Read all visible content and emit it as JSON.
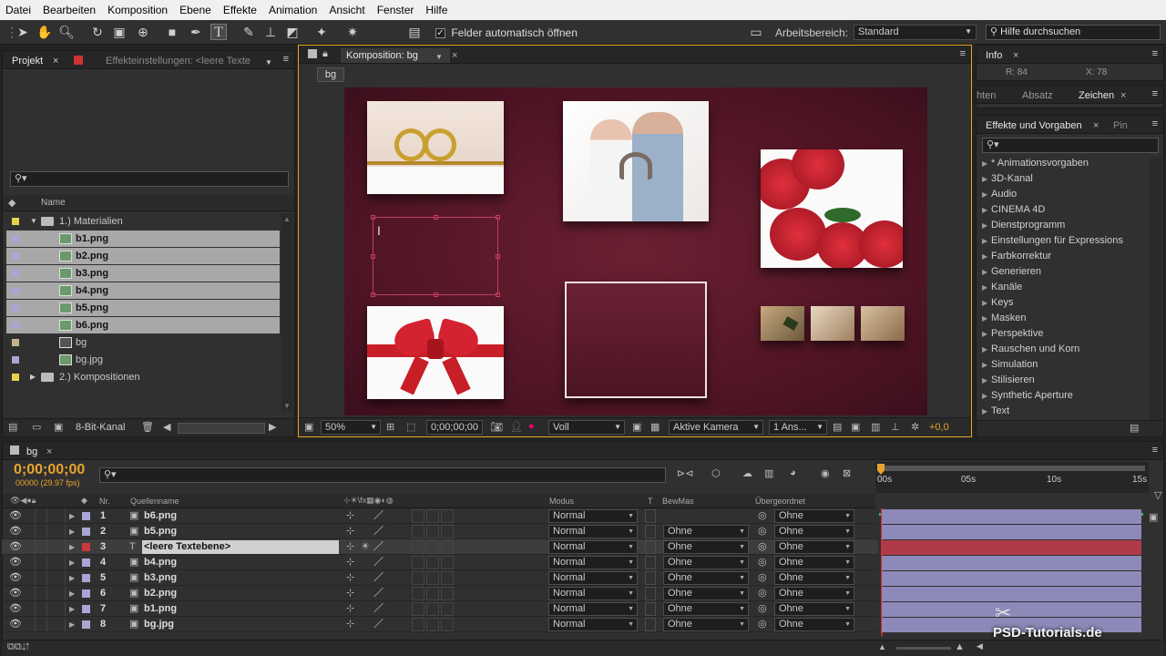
{
  "menu": [
    "Datei",
    "Bearbeiten",
    "Komposition",
    "Ebene",
    "Effekte",
    "Animation",
    "Ansicht",
    "Fenster",
    "Hilfe"
  ],
  "toolbar": {
    "auto_open_label": "Felder automatisch öffnen",
    "workspace_label": "Arbeitsbereich:",
    "workspace_value": "Standard",
    "help_placeholder": "Hilfe durchsuchen"
  },
  "project_panel": {
    "tab_project": "Projekt",
    "tab_effects": "Effekteinstellungen: <leere Texte",
    "column_name": "Name",
    "bit_depth": "8-Bit-Kanal",
    "items": [
      {
        "name": "1.) Materialien",
        "type": "folder",
        "color": "#e6d24a",
        "level": 0,
        "expanded": true,
        "selected": false
      },
      {
        "name": "b1.png",
        "type": "image",
        "color": "#a9a6d6",
        "level": 1,
        "selected": true
      },
      {
        "name": "b2.png",
        "type": "image",
        "color": "#a9a6d6",
        "level": 1,
        "selected": true
      },
      {
        "name": "b3.png",
        "type": "image",
        "color": "#a9a6d6",
        "level": 1,
        "selected": true
      },
      {
        "name": "b4.png",
        "type": "image",
        "color": "#a9a6d6",
        "level": 1,
        "selected": true
      },
      {
        "name": "b5.png",
        "type": "image",
        "color": "#a9a6d6",
        "level": 1,
        "selected": true
      },
      {
        "name": "b6.png",
        "type": "image",
        "color": "#a9a6d6",
        "level": 1,
        "selected": true
      },
      {
        "name": "bg",
        "type": "comp",
        "color": "#c4b28e",
        "level": 1,
        "selected": false
      },
      {
        "name": "bg.jpg",
        "type": "image",
        "color": "#a9a6d6",
        "level": 1,
        "selected": false
      },
      {
        "name": "2.) Kompositionen",
        "type": "folder",
        "color": "#e6d24a",
        "level": 0,
        "expanded": false,
        "selected": false
      }
    ]
  },
  "composition_panel": {
    "tab_label": "Komposition: bg",
    "breadcrumb": "bg",
    "zoom": "50%",
    "timecode": "0;00;00;00",
    "resolution": "Voll",
    "camera": "Aktive Kamera",
    "views": "1 Ans...",
    "exposure": "+0,0"
  },
  "info_panel": {
    "tab_label": "Info",
    "r_label": "R: 84",
    "x_label": "X: 78"
  },
  "char_panel": {
    "tabs": [
      "hten",
      "Absatz",
      "Zeichen"
    ]
  },
  "effects_panel": {
    "tab_label": "Effekte und Vorgaben",
    "tab_pinsel": "Pin",
    "items": [
      "* Animationsvorgaben",
      "3D-Kanal",
      "Audio",
      "CINEMA 4D",
      "Dienstprogramm",
      "Einstellungen für Expressions",
      "Farbkorrektur",
      "Generieren",
      "Kanäle",
      "Keys",
      "Masken",
      "Perspektive",
      "Rauschen und Korn",
      "Simulation",
      "Stilisieren",
      "Synthetic Aperture",
      "Text"
    ]
  },
  "timeline": {
    "tab_label": "bg",
    "timecode": "0;00;00;00",
    "frame_info": "00000 (29.97 fps)",
    "columns": {
      "nr": "Nr.",
      "source": "Quellenname",
      "mode": "Modus",
      "t": "T",
      "trkmat": "BewMas",
      "parent": "Übergeordnet"
    },
    "ruler": [
      "00s",
      "05s",
      "10s",
      "15s"
    ],
    "layers": [
      {
        "nr": "1",
        "name": "b6.png",
        "type": "image",
        "color": "#a9a6d6",
        "mode": "Normal",
        "trkmat": "",
        "parent": "Ohne",
        "selected": false
      },
      {
        "nr": "2",
        "name": "b5.png",
        "type": "image",
        "color": "#a9a6d6",
        "mode": "Normal",
        "trkmat": "Ohne",
        "parent": "Ohne",
        "selected": false
      },
      {
        "nr": "3",
        "name": "<leere Textebene>",
        "type": "text",
        "color": "#c8383c",
        "mode": "Normal",
        "trkmat": "Ohne",
        "parent": "Ohne",
        "selected": true
      },
      {
        "nr": "4",
        "name": "b4.png",
        "type": "image",
        "color": "#a9a6d6",
        "mode": "Normal",
        "trkmat": "Ohne",
        "parent": "Ohne",
        "selected": false
      },
      {
        "nr": "5",
        "name": "b3.png",
        "type": "image",
        "color": "#a9a6d6",
        "mode": "Normal",
        "trkmat": "Ohne",
        "parent": "Ohne",
        "selected": false
      },
      {
        "nr": "6",
        "name": "b2.png",
        "type": "image",
        "color": "#a9a6d6",
        "mode": "Normal",
        "trkmat": "Ohne",
        "parent": "Ohne",
        "selected": false
      },
      {
        "nr": "7",
        "name": "b1.png",
        "type": "image",
        "color": "#a9a6d6",
        "mode": "Normal",
        "trkmat": "Ohne",
        "parent": "Ohne",
        "selected": false
      },
      {
        "nr": "8",
        "name": "bg.jpg",
        "type": "image",
        "color": "#a9a6d6",
        "mode": "Normal",
        "trkmat": "Ohne",
        "parent": "Ohne",
        "selected": false
      }
    ]
  },
  "watermark": "PSD-Tutorials.de",
  "colors": {
    "accent_orange": "#e8a42a",
    "comp_bg": "#5a1a2a",
    "timeline_bar": "#8d89b8",
    "selected_bar": "#b03a4a"
  }
}
